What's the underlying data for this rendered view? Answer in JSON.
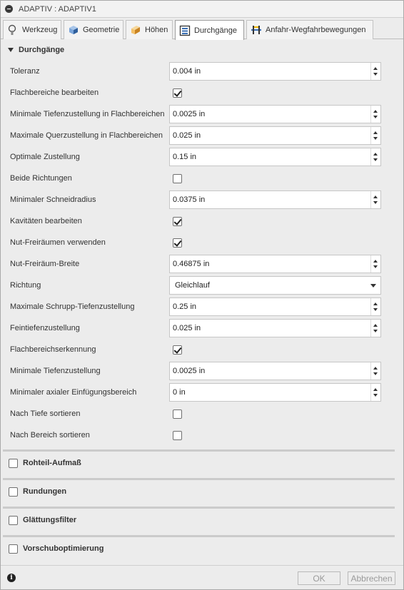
{
  "window": {
    "title": "ADAPTIV : ADAPTIV1"
  },
  "tabs": [
    {
      "label": "Werkzeug",
      "icon": "tool-icon"
    },
    {
      "label": "Geometrie",
      "icon": "geometry-icon"
    },
    {
      "label": "Höhen",
      "icon": "heights-icon"
    },
    {
      "label": "Durchgänge",
      "icon": "passes-icon",
      "active": true
    },
    {
      "label": "Anfahr-Wegfahrbewegungen",
      "icon": "linking-icon"
    }
  ],
  "section": {
    "title": "Durchgänge"
  },
  "fields": {
    "toleranz": {
      "label": "Toleranz",
      "value": "0.004 in"
    },
    "flachbereiche": {
      "label": "Flachbereiche bearbeiten",
      "checked": true
    },
    "min_tiefenzustellung_flach": {
      "label": "Minimale Tiefenzustellung in Flachbereichen",
      "value": "0.0025 in"
    },
    "max_querzustellung_flach": {
      "label": "Maximale Querzustellung in Flachbereichen",
      "value": "0.025 in"
    },
    "optimale_zustellung": {
      "label": "Optimale Zustellung",
      "value": "0.15 in"
    },
    "beide_richtungen": {
      "label": "Beide Richtungen",
      "checked": false
    },
    "min_schneidradius": {
      "label": "Minimaler Schneidradius",
      "value": "0.0375 in"
    },
    "kavitaeten": {
      "label": "Kavitäten bearbeiten",
      "checked": true
    },
    "nut_freiraeumen": {
      "label": "Nut-Freiräumen verwenden",
      "checked": true
    },
    "nut_freiraeum_breite": {
      "label": "Nut-Freiräum-Breite",
      "value": "0.46875 in"
    },
    "richtung": {
      "label": "Richtung",
      "value": "Gleichlauf"
    },
    "max_schrupp_tiefenzustellung": {
      "label": "Maximale Schrupp-Tiefenzustellung",
      "value": "0.25 in"
    },
    "feintiefenzustellung": {
      "label": "Feintiefenzustellung",
      "value": "0.025 in"
    },
    "flachbereichserkennung": {
      "label": "Flachbereichserkennung",
      "checked": true
    },
    "min_tiefenzustellung": {
      "label": "Minimale Tiefenzustellung",
      "value": "0.0025 in"
    },
    "min_axialer_einfuegebereich": {
      "label": "Minimaler axialer Einfügungsbereich",
      "value": "0 in"
    },
    "nach_tiefe": {
      "label": "Nach Tiefe sortieren",
      "checked": false
    },
    "nach_bereich": {
      "label": "Nach Bereich sortieren",
      "checked": false
    }
  },
  "collapsed_sections": [
    {
      "label": "Rohteil-Aufmaß"
    },
    {
      "label": "Rundungen"
    },
    {
      "label": "Glättungsfilter"
    },
    {
      "label": "Vorschuboptimierung"
    }
  ],
  "footer": {
    "ok_label": "OK",
    "cancel_label": "Abbrechen",
    "info_icon": "info-icon"
  }
}
